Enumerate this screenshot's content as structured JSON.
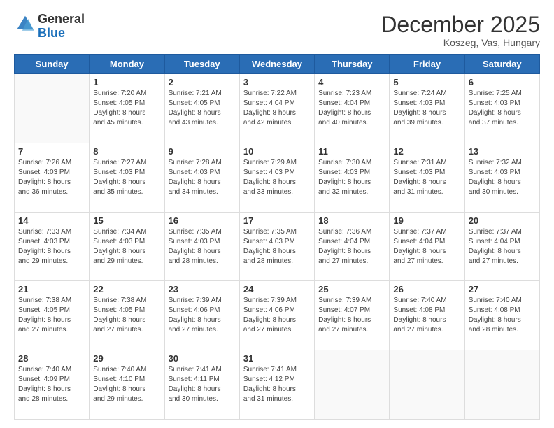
{
  "header": {
    "logo_general": "General",
    "logo_blue": "Blue",
    "month_title": "December 2025",
    "location": "Koszeg, Vas, Hungary"
  },
  "days_of_week": [
    "Sunday",
    "Monday",
    "Tuesday",
    "Wednesday",
    "Thursday",
    "Friday",
    "Saturday"
  ],
  "weeks": [
    [
      {
        "day": "",
        "info": ""
      },
      {
        "day": "1",
        "info": "Sunrise: 7:20 AM\nSunset: 4:05 PM\nDaylight: 8 hours\nand 45 minutes."
      },
      {
        "day": "2",
        "info": "Sunrise: 7:21 AM\nSunset: 4:05 PM\nDaylight: 8 hours\nand 43 minutes."
      },
      {
        "day": "3",
        "info": "Sunrise: 7:22 AM\nSunset: 4:04 PM\nDaylight: 8 hours\nand 42 minutes."
      },
      {
        "day": "4",
        "info": "Sunrise: 7:23 AM\nSunset: 4:04 PM\nDaylight: 8 hours\nand 40 minutes."
      },
      {
        "day": "5",
        "info": "Sunrise: 7:24 AM\nSunset: 4:03 PM\nDaylight: 8 hours\nand 39 minutes."
      },
      {
        "day": "6",
        "info": "Sunrise: 7:25 AM\nSunset: 4:03 PM\nDaylight: 8 hours\nand 37 minutes."
      }
    ],
    [
      {
        "day": "7",
        "info": "Sunrise: 7:26 AM\nSunset: 4:03 PM\nDaylight: 8 hours\nand 36 minutes."
      },
      {
        "day": "8",
        "info": "Sunrise: 7:27 AM\nSunset: 4:03 PM\nDaylight: 8 hours\nand 35 minutes."
      },
      {
        "day": "9",
        "info": "Sunrise: 7:28 AM\nSunset: 4:03 PM\nDaylight: 8 hours\nand 34 minutes."
      },
      {
        "day": "10",
        "info": "Sunrise: 7:29 AM\nSunset: 4:03 PM\nDaylight: 8 hours\nand 33 minutes."
      },
      {
        "day": "11",
        "info": "Sunrise: 7:30 AM\nSunset: 4:03 PM\nDaylight: 8 hours\nand 32 minutes."
      },
      {
        "day": "12",
        "info": "Sunrise: 7:31 AM\nSunset: 4:03 PM\nDaylight: 8 hours\nand 31 minutes."
      },
      {
        "day": "13",
        "info": "Sunrise: 7:32 AM\nSunset: 4:03 PM\nDaylight: 8 hours\nand 30 minutes."
      }
    ],
    [
      {
        "day": "14",
        "info": "Sunrise: 7:33 AM\nSunset: 4:03 PM\nDaylight: 8 hours\nand 29 minutes."
      },
      {
        "day": "15",
        "info": "Sunrise: 7:34 AM\nSunset: 4:03 PM\nDaylight: 8 hours\nand 29 minutes."
      },
      {
        "day": "16",
        "info": "Sunrise: 7:35 AM\nSunset: 4:03 PM\nDaylight: 8 hours\nand 28 minutes."
      },
      {
        "day": "17",
        "info": "Sunrise: 7:35 AM\nSunset: 4:03 PM\nDaylight: 8 hours\nand 28 minutes."
      },
      {
        "day": "18",
        "info": "Sunrise: 7:36 AM\nSunset: 4:04 PM\nDaylight: 8 hours\nand 27 minutes."
      },
      {
        "day": "19",
        "info": "Sunrise: 7:37 AM\nSunset: 4:04 PM\nDaylight: 8 hours\nand 27 minutes."
      },
      {
        "day": "20",
        "info": "Sunrise: 7:37 AM\nSunset: 4:04 PM\nDaylight: 8 hours\nand 27 minutes."
      }
    ],
    [
      {
        "day": "21",
        "info": "Sunrise: 7:38 AM\nSunset: 4:05 PM\nDaylight: 8 hours\nand 27 minutes."
      },
      {
        "day": "22",
        "info": "Sunrise: 7:38 AM\nSunset: 4:05 PM\nDaylight: 8 hours\nand 27 minutes."
      },
      {
        "day": "23",
        "info": "Sunrise: 7:39 AM\nSunset: 4:06 PM\nDaylight: 8 hours\nand 27 minutes."
      },
      {
        "day": "24",
        "info": "Sunrise: 7:39 AM\nSunset: 4:06 PM\nDaylight: 8 hours\nand 27 minutes."
      },
      {
        "day": "25",
        "info": "Sunrise: 7:39 AM\nSunset: 4:07 PM\nDaylight: 8 hours\nand 27 minutes."
      },
      {
        "day": "26",
        "info": "Sunrise: 7:40 AM\nSunset: 4:08 PM\nDaylight: 8 hours\nand 27 minutes."
      },
      {
        "day": "27",
        "info": "Sunrise: 7:40 AM\nSunset: 4:08 PM\nDaylight: 8 hours\nand 28 minutes."
      }
    ],
    [
      {
        "day": "28",
        "info": "Sunrise: 7:40 AM\nSunset: 4:09 PM\nDaylight: 8 hours\nand 28 minutes."
      },
      {
        "day": "29",
        "info": "Sunrise: 7:40 AM\nSunset: 4:10 PM\nDaylight: 8 hours\nand 29 minutes."
      },
      {
        "day": "30",
        "info": "Sunrise: 7:41 AM\nSunset: 4:11 PM\nDaylight: 8 hours\nand 30 minutes."
      },
      {
        "day": "31",
        "info": "Sunrise: 7:41 AM\nSunset: 4:12 PM\nDaylight: 8 hours\nand 31 minutes."
      },
      {
        "day": "",
        "info": ""
      },
      {
        "day": "",
        "info": ""
      },
      {
        "day": "",
        "info": ""
      }
    ]
  ]
}
